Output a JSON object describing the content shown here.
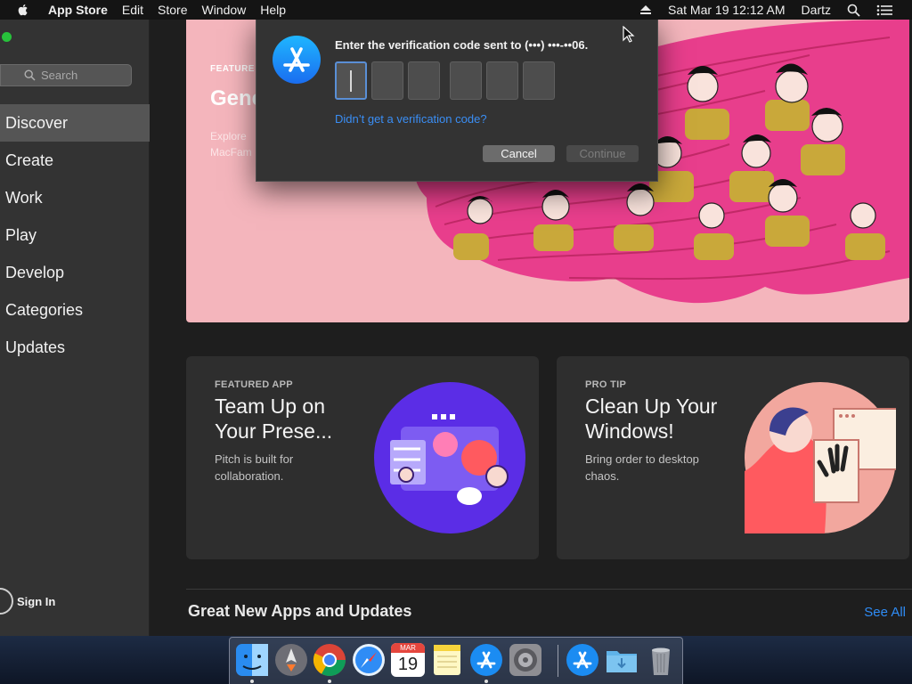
{
  "menubar": {
    "app_name": "App Store",
    "menus": [
      "Edit",
      "Store",
      "Window",
      "Help"
    ],
    "datetime": "Sat Mar 19  12:12 AM",
    "user": "Dartz"
  },
  "sidebar": {
    "search_placeholder": "Search",
    "items": [
      {
        "label": "Discover",
        "active": true
      },
      {
        "label": "Create"
      },
      {
        "label": "Work"
      },
      {
        "label": "Play"
      },
      {
        "label": "Develop"
      },
      {
        "label": "Categories"
      },
      {
        "label": "Updates"
      }
    ],
    "sign_in": "Sign In"
  },
  "hero": {
    "kicker": "FEATURE",
    "title": "Gene",
    "subtitle_lines": [
      "Explore",
      "MacFam"
    ]
  },
  "cards": [
    {
      "kicker": "FEATURED APP",
      "title": "Team Up on Your Prese...",
      "desc": "Pitch is built for collaboration."
    },
    {
      "kicker": "PRO TIP",
      "title": "Clean Up Your Windows!",
      "desc": "Bring order to desktop chaos."
    }
  ],
  "section": {
    "title": "Great New Apps and Updates",
    "see_all": "See All"
  },
  "dialog": {
    "prompt": "Enter the verification code sent to (•••) •••-••06.",
    "link": "Didn’t get a verification code?",
    "cancel": "Cancel",
    "continue": "Continue"
  },
  "dock": {
    "calendar_month": "MAR",
    "calendar_day": "19",
    "apps": [
      "finder-icon",
      "launchpad-icon",
      "chrome-icon",
      "safari-icon",
      "calendar-icon",
      "notes-icon",
      "app-store-icon",
      "system-preferences-icon",
      "app-store-download-icon",
      "downloads-folder-icon",
      "trash-icon"
    ]
  },
  "colors": {
    "accent": "#2f8cf5",
    "hero_bg": "#f4b5bc",
    "hero_art": "#e83e8c"
  }
}
